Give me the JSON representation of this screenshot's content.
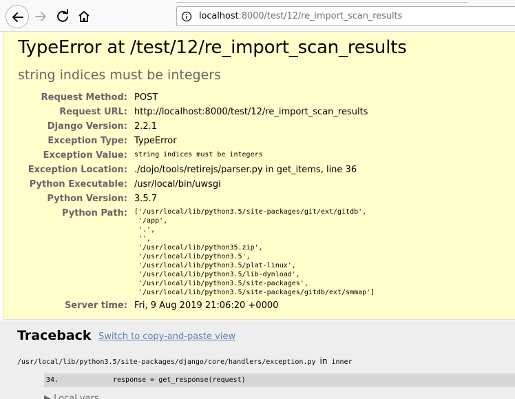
{
  "browser": {
    "url_host": "localhost",
    "url_rest": ":8000/test/12/re_import_scan_results",
    "icons": [
      "back-icon",
      "forward-icon",
      "reload-icon",
      "home-icon",
      "info-icon"
    ]
  },
  "error": {
    "title": "TypeError at /test/12/re_import_scan_results",
    "subtitle": "string indices must be integers"
  },
  "meta": [
    {
      "label": "Request Method:",
      "value": "POST"
    },
    {
      "label": "Request URL:",
      "value": "http://localhost:8000/test/12/re_import_scan_results"
    },
    {
      "label": "Django Version:",
      "value": "2.2.1"
    },
    {
      "label": "Exception Type:",
      "value": "TypeError"
    },
    {
      "label": "Exception Value:",
      "value": "string indices must be integers"
    },
    {
      "label": "Exception Location:",
      "value": "./dojo/tools/retirejs/parser.py in get_items, line 36"
    },
    {
      "label": "Python Executable:",
      "value": "/usr/local/bin/uwsgi"
    },
    {
      "label": "Python Version:",
      "value": "3.5.7"
    },
    {
      "label": "Python Path:",
      "value": ""
    },
    {
      "label": "Server time:",
      "value": "Fri, 9 Aug 2019 21:06:20 +0000"
    }
  ],
  "python_path": [
    "['/usr/local/lib/python3.5/site-packages/git/ext/gitdb',",
    " '/app',",
    " '.',",
    " '',",
    " '/usr/local/lib/python35.zip',",
    " '/usr/local/lib/python3.5',",
    " '/usr/local/lib/python3.5/plat-linux',",
    " '/usr/local/lib/python3.5/lib-dynload',",
    " '/usr/local/lib/python3.5/site-packages',",
    " '/usr/local/lib/python3.5/site-packages/gitdb/ext/smmap']"
  ],
  "traceback": {
    "title": "Traceback",
    "switch_link": "Switch to copy-and-paste view",
    "frame_file": "/usr/local/lib/python3.5/site-packages/django/core/handlers/exception.py",
    "frame_in": "in",
    "frame_func": "inner",
    "line_num": "34.",
    "line_code": "response = get_response(request)",
    "local_vars": "Local vars"
  }
}
